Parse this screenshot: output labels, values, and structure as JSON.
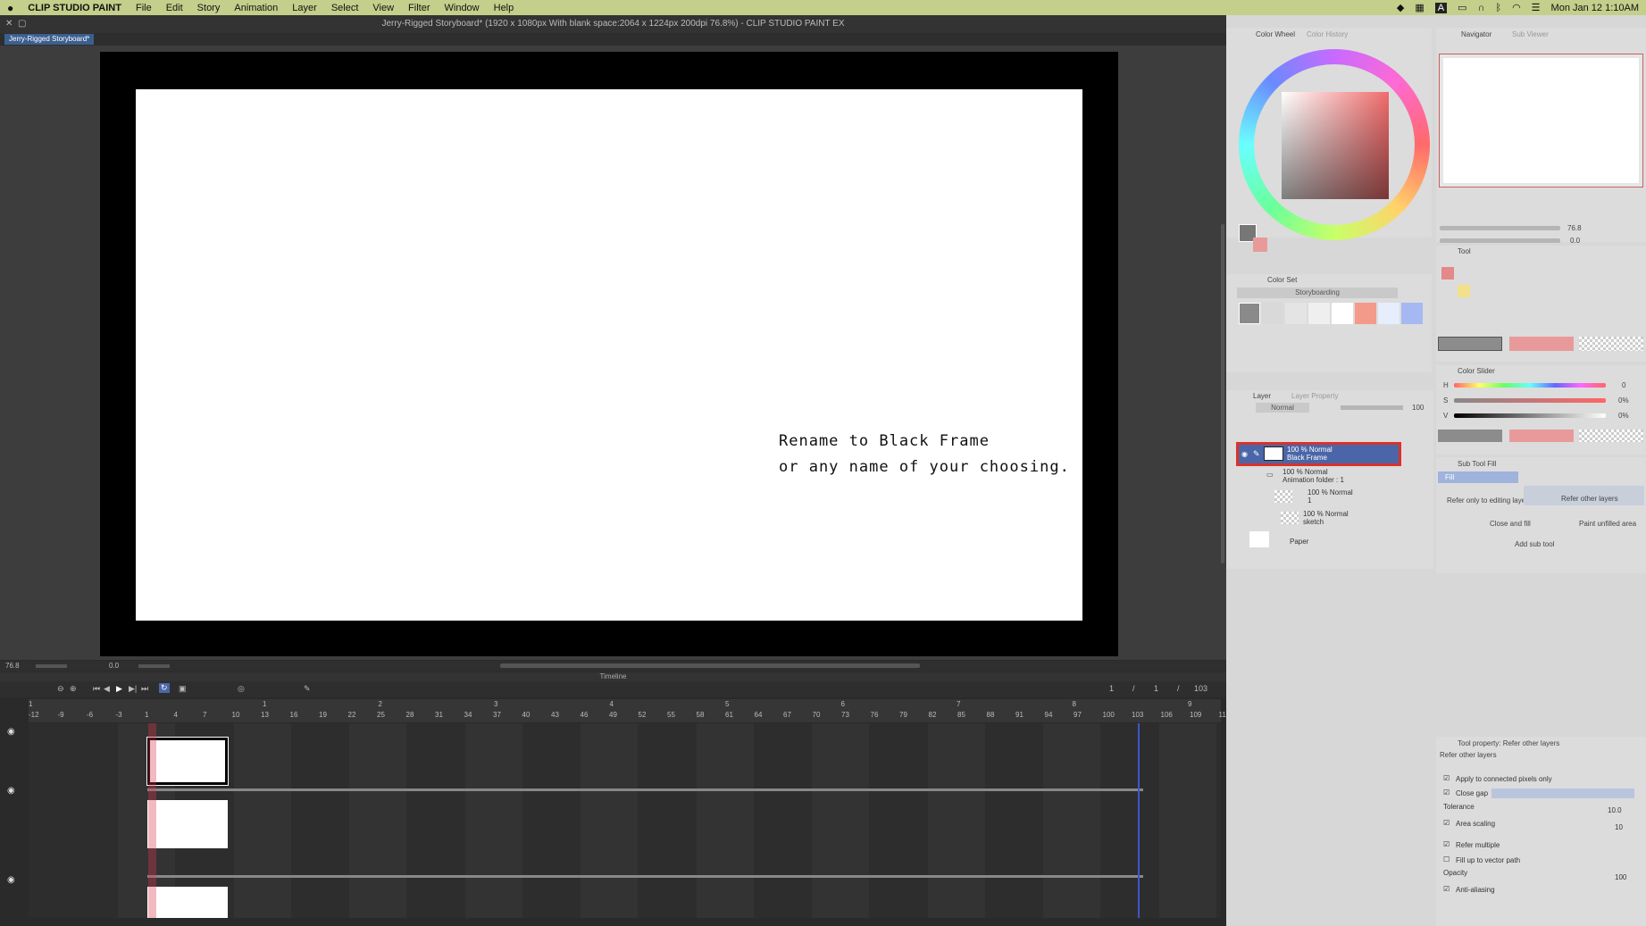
{
  "menubar": {
    "apple": "",
    "app": "CLIP STUDIO PAINT",
    "items": [
      "File",
      "Edit",
      "Story",
      "Animation",
      "Layer",
      "Select",
      "View",
      "Filter",
      "Window",
      "Help"
    ],
    "clock": "Mon Jan 12  1:10AM",
    "input_indicator": "A"
  },
  "window": {
    "title": "Jerry-Rigged Storyboard* (1920 x 1080px With blank space:2064 x 1224px 200dpi 76.8%)  - CLIP STUDIO PAINT EX",
    "tab": "Jerry-Rigged Storyboard*"
  },
  "canvas": {
    "note_line1": "Rename to Black Frame",
    "note_line2": "or any name of your choosing.",
    "zoom": "76.8",
    "rotation": "0.0"
  },
  "timeline": {
    "title": "Timeline",
    "frame_current": "1",
    "frame_start": "1",
    "frame_end": "103",
    "ruler_numbers": [
      "-12",
      "-9",
      "-6",
      "-3",
      "1",
      "4",
      "7",
      "10",
      "13",
      "16",
      "19",
      "22",
      "25",
      "28",
      "31",
      "34",
      "37",
      "40",
      "43",
      "46",
      "49",
      "52",
      "55",
      "58",
      "61",
      "64",
      "67",
      "70",
      "73",
      "76",
      "79",
      "82",
      "85",
      "88",
      "91",
      "94",
      "97",
      "100",
      "103",
      "106",
      "109",
      "11"
    ],
    "second_marks": [
      "1",
      "1",
      "2",
      "3",
      "4",
      "5",
      "6",
      "7",
      "8",
      "9"
    ]
  },
  "color_wheel": {
    "tab1": "Color Wheel",
    "tab2": "Color History",
    "hsv": [
      "0",
      "0",
      "0"
    ]
  },
  "color_set": {
    "title": "Color Set",
    "set_name": "Storyboarding",
    "swatches": [
      "#8a8a8a",
      "#d9d9d9",
      "#e4e4e4",
      "#efefef",
      "#ffffff",
      "#f39a8a",
      "#e6eefc",
      "#a5b8f2"
    ]
  },
  "navigator": {
    "tab1": "Navigator",
    "tab2": "Sub Viewer",
    "zoom": "76.8",
    "angle": "0.0"
  },
  "tool": {
    "title": "Tool"
  },
  "color_slider": {
    "title": "Color Slider",
    "h": "0",
    "s": "0%",
    "v": "0%",
    "h_label": "H",
    "s_label": "S",
    "v_label": "V"
  },
  "sub_tool": {
    "title": "Sub Tool Fill",
    "active": "Fill",
    "refer_editing": "Refer only to editing layer",
    "refer_other": "Refer other layers",
    "close_fill": "Close and fill",
    "paint_unfilled": "Paint unfilled area",
    "add_sub_tool": "Add sub tool"
  },
  "layer": {
    "tab1": "Layer",
    "tab2": "Layer Property",
    "blend": "Normal",
    "opacity": "100",
    "rows": [
      {
        "line1": "100 % Normal",
        "line2": "Black Frame"
      },
      {
        "line1": "100 % Normal",
        "line2": "Animation folder : 1"
      },
      {
        "line1": "100 % Normal",
        "line2": "1"
      },
      {
        "line1": "100 % Normal",
        "line2": "sketch"
      },
      {
        "line1": "",
        "line2": "Paper"
      }
    ]
  },
  "tool_property": {
    "title": "Tool property: Refer other layers",
    "subtitle": "Refer other layers",
    "apply_connected": "Apply to connected pixels only",
    "close_gap": "Close gap",
    "tolerance_label": "Tolerance",
    "tolerance": "10.0",
    "area_scaling": "Area scaling",
    "area_value": "10",
    "refer_multiple": "Refer multiple",
    "fill_vector": "Fill up to vector path",
    "opacity_label": "Opacity",
    "opacity": "100",
    "anti_aliasing": "Anti-aliasing"
  },
  "colors": {
    "menubar": "#c3cf8a",
    "highlight": "#d9322a",
    "selected_layer": "#4b66a8",
    "playhead": "#d9364a"
  }
}
